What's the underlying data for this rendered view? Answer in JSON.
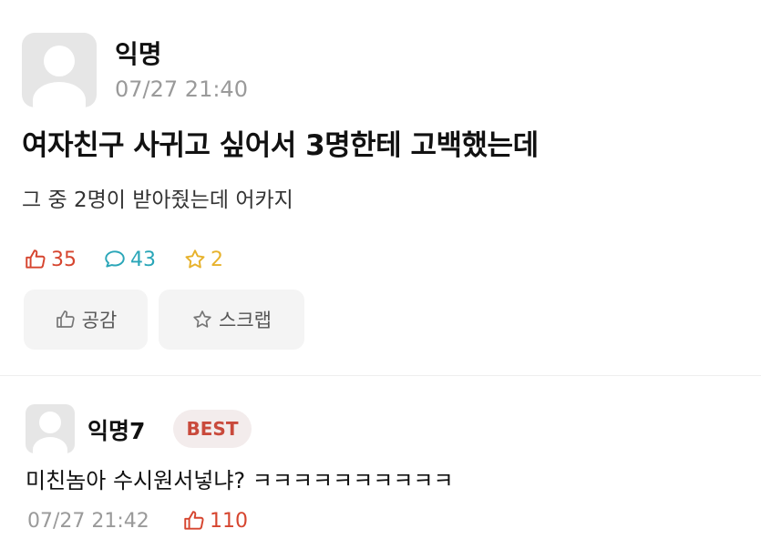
{
  "post": {
    "author": "익명",
    "time": "07/27 21:40",
    "title": "여자친구 사귀고 싶어서 3명한테 고백했는데",
    "body": "그 중 2명이 받아줬는데 어카지",
    "stats": {
      "likes": "35",
      "comments": "43",
      "scraps": "2"
    },
    "buttons": {
      "like_label": "공감",
      "scrap_label": "스크랩"
    }
  },
  "comment": {
    "author": "익명7",
    "badge": "BEST",
    "text": "미친놈아 수시원서넣냐? ㅋㅋㅋㅋㅋㅋㅋㅋㅋㅋ",
    "time": "07/27 21:42",
    "likes": "110"
  },
  "icons": {
    "like": "thumbs-up-icon",
    "comment": "speech-bubble-icon",
    "scrap": "star-icon",
    "avatar": "default-user-avatar"
  },
  "colors": {
    "like": "#d6452f",
    "comment": "#2aa6b8",
    "scrap": "#e7b22c",
    "best_badge_text": "#c94a3c",
    "best_badge_bg": "#f3ecec",
    "timestamp": "#9a9a9a"
  }
}
